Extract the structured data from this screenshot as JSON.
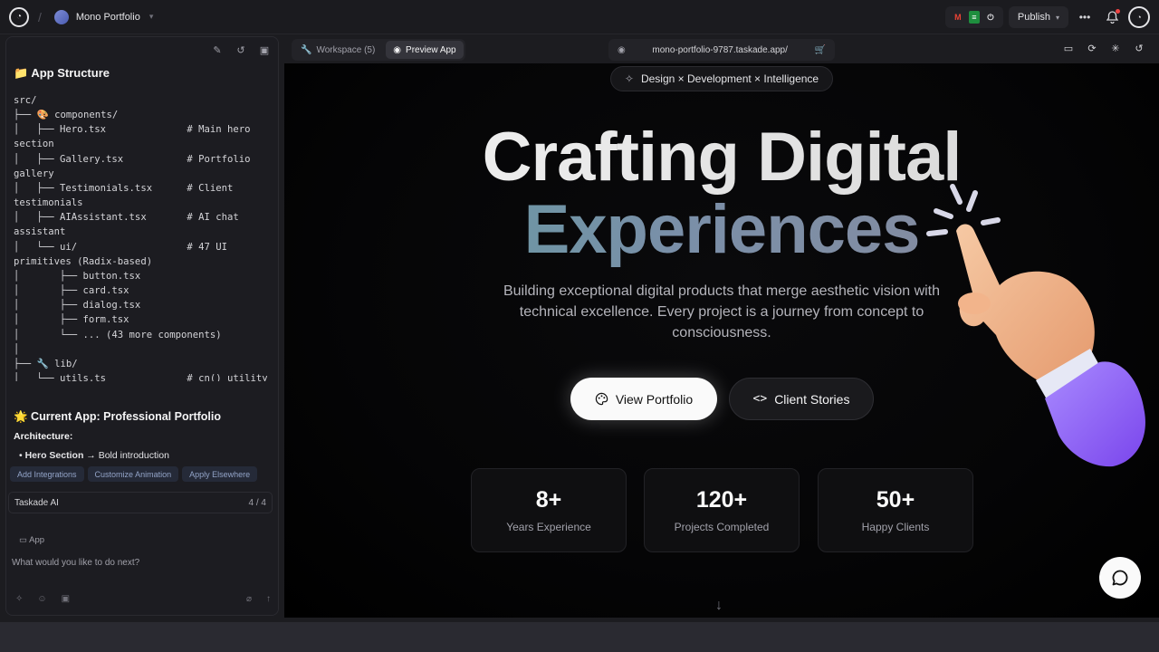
{
  "topbar": {
    "project_name": "Mono Portfolio",
    "publish_label": "Publish"
  },
  "sidebar": {
    "heading": "📁 App Structure",
    "tree_lines": [
      "src/",
      "├── 🎨 components/",
      "│   ├── Hero.tsx              # Main hero",
      "section",
      "│   ├── Gallery.tsx           # Portfolio",
      "gallery",
      "│   ├── Testimonials.tsx      # Client",
      "testimonials",
      "│   ├── AIAssistant.tsx       # AI chat",
      "assistant",
      "│   └── ui/                   # 47 UI",
      "primitives (Radix-based)",
      "│       ├── button.tsx",
      "│       ├── card.tsx",
      "│       ├── dialog.tsx",
      "│       ├── form.tsx",
      "│       └── ... (43 more components)",
      "│",
      "├── 🔧 lib/",
      "│   └── utils.ts              # cn() utility"
    ],
    "current_app_heading": "🌟 Current App: Professional Portfolio",
    "architecture_label": "Architecture:",
    "bullet_bold": "Hero Section",
    "bullet_rest": " → Bold introduction",
    "chips": [
      "Add Integrations",
      "Customize Animation",
      "Apply Elsewhere"
    ],
    "ai_label": "Taskade AI",
    "ai_count": "4 / 4",
    "app_tag": "App",
    "prompt_placeholder": "What would you like to do next?"
  },
  "preview_bar": {
    "workspace_tab": "Workspace (5)",
    "preview_tab": "Preview App",
    "url": "mono-portfolio-9787.taskade.app/"
  },
  "hero": {
    "pill": "Design × Development × Intelligence",
    "title_line1": "Crafting Digital",
    "title_line2": "Experiences",
    "subtitle": "Building exceptional digital products that merge aesthetic vision with technical excellence. Every project is a journey from concept to consciousness.",
    "primary_button": "View Portfolio",
    "secondary_button": "Client Stories"
  },
  "stats": [
    {
      "value": "8+",
      "label": "Years Experience"
    },
    {
      "value": "120+",
      "label": "Projects Completed"
    },
    {
      "value": "50+",
      "label": "Happy Clients"
    }
  ],
  "colors": {
    "accent_teal": "#5f9ea0",
    "hand_sleeve": "#8b5cf6"
  }
}
